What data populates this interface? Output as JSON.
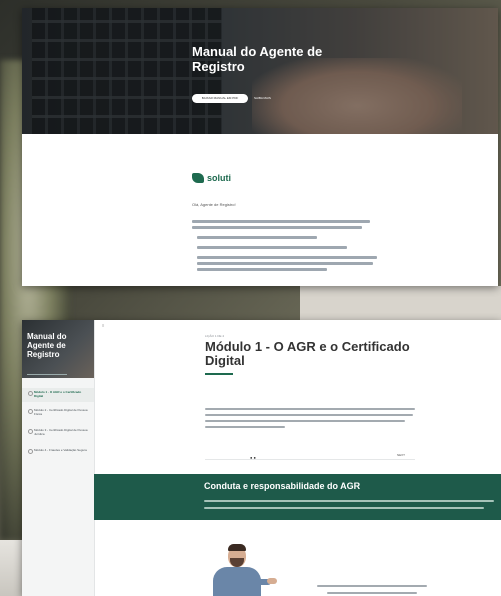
{
  "card1": {
    "hero_title": "Manual do Agente de Registro",
    "hero_primary_button": "BAIXAR MANUAL EM PDF",
    "hero_secondary_link": "SAIBA MAIS",
    "brand_name": "soluti",
    "greeting": "Olá, Agente de Registro!"
  },
  "card2": {
    "sidebar_title": "Manual do Agente de Registro",
    "sidebar_items": [
      "Módulo 1 - O AGR e o Certificado Digital",
      "Módulo 2 - Certificado Digital de Pessoa Física",
      "Módulo 3 - Certificado Digital de Pessoa Jurídica",
      "Módulo 4 - Fraudes e Validação Segura"
    ],
    "breadcrumb": "LIÇÃO 1 DE 4",
    "module_title": "Módulo 1 - O AGR e o Certificado Digital",
    "next_label": "NEXT",
    "banner_title": "Conduta e responsabilidade do AGR"
  },
  "colors": {
    "brand_green": "#1e6a4f",
    "banner_green": "#1e5a4a"
  }
}
